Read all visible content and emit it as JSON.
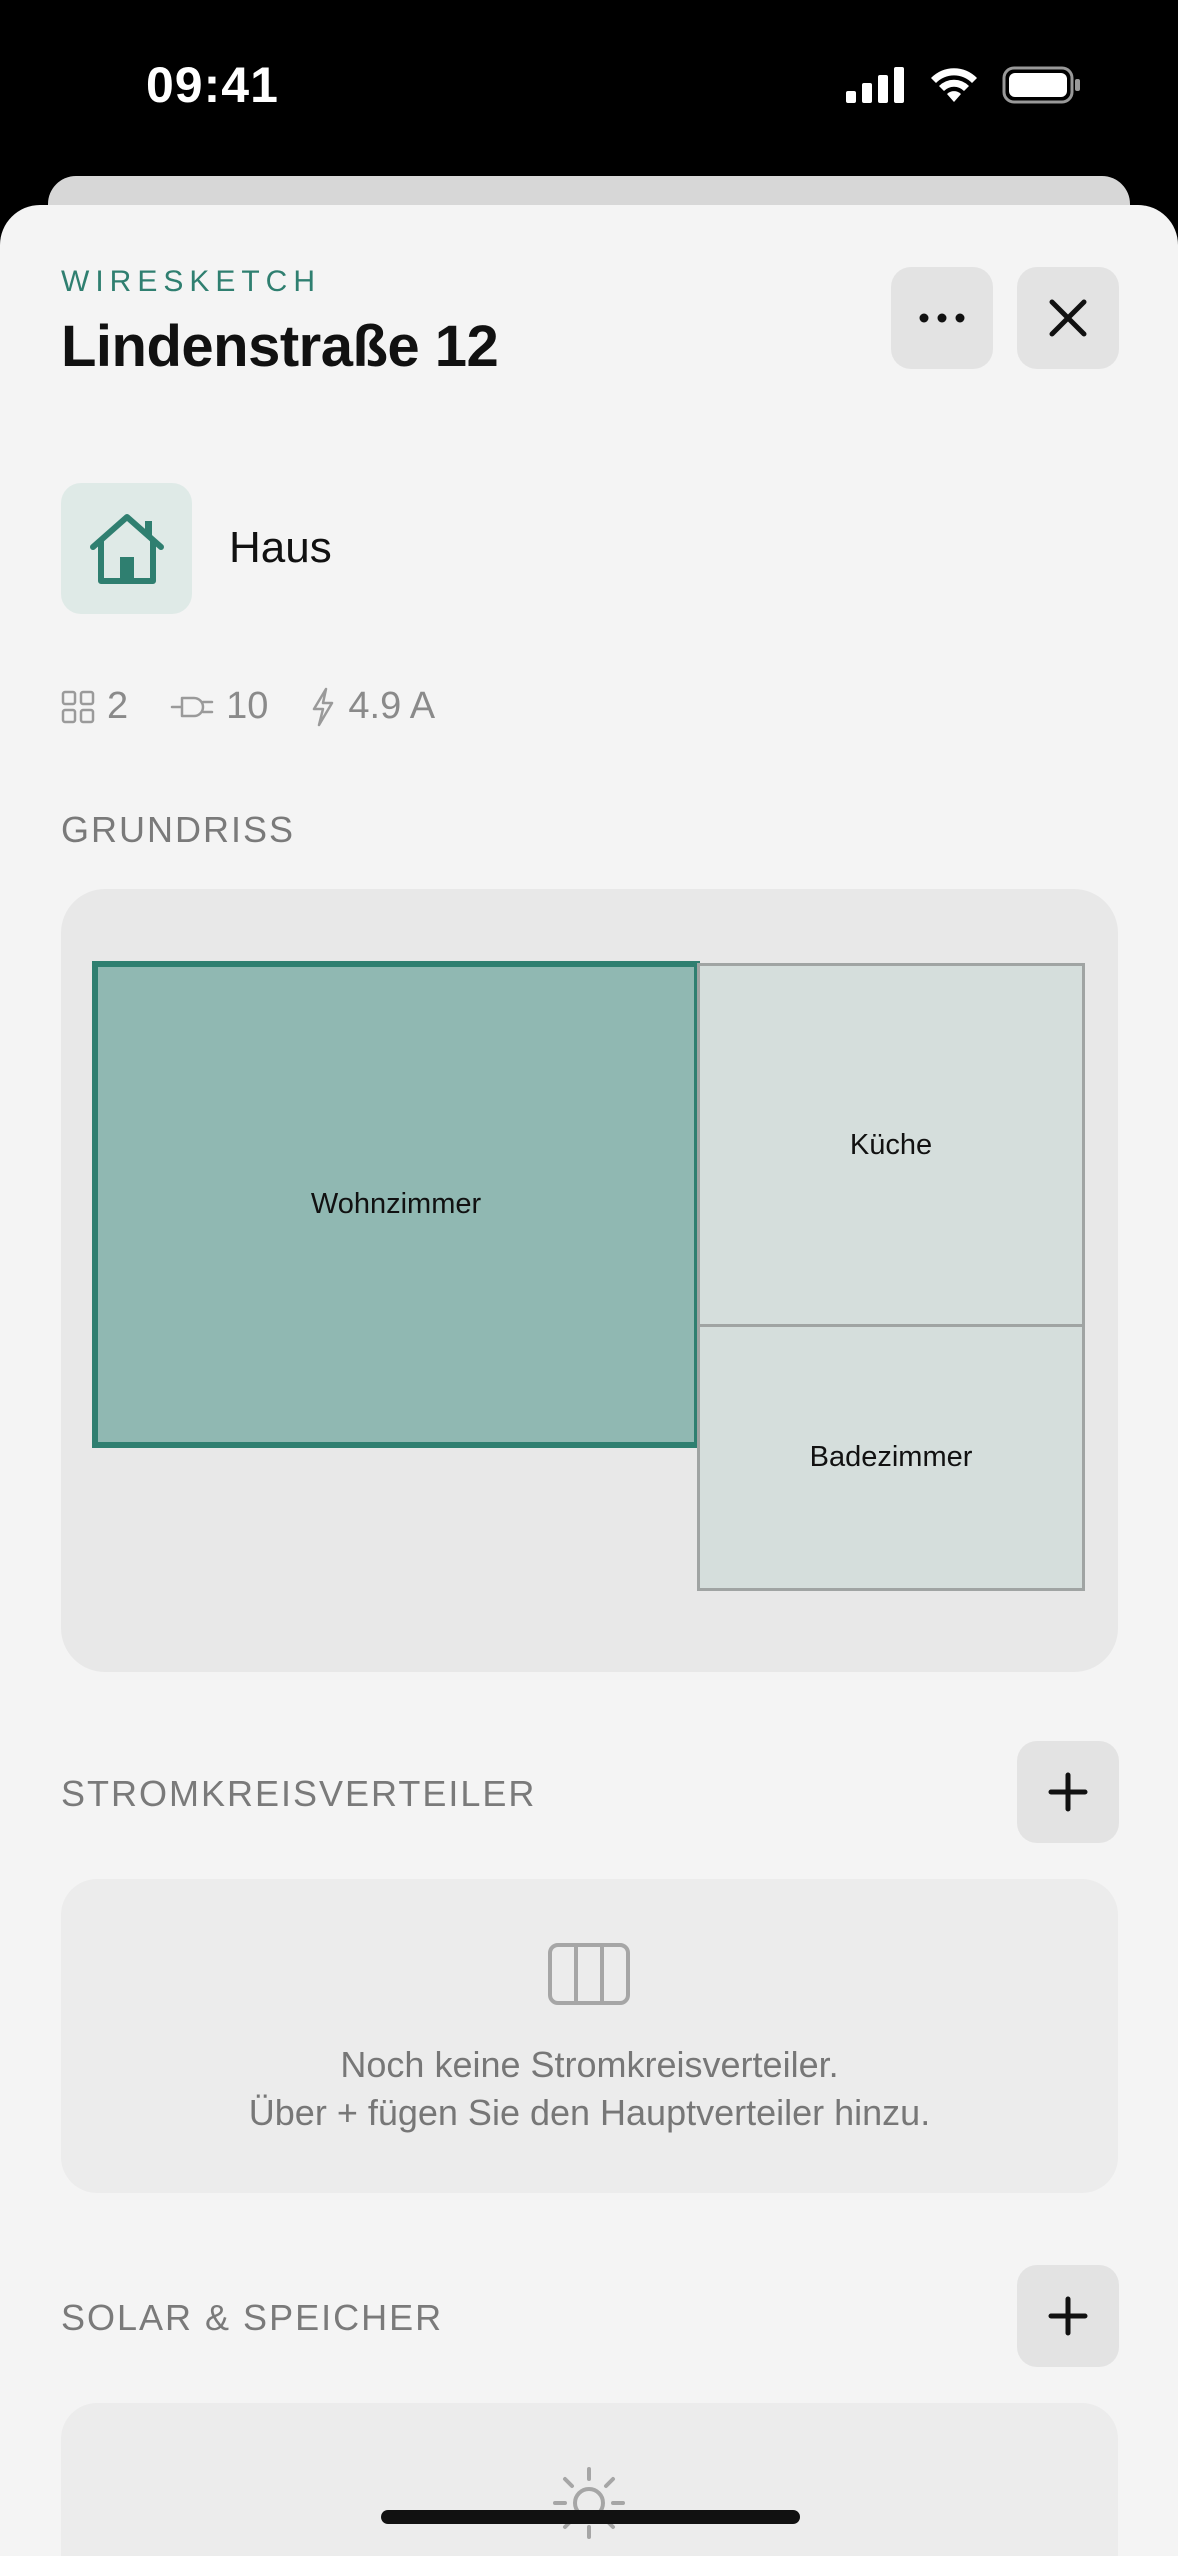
{
  "status": {
    "time": "09:41"
  },
  "header": {
    "brand": "WIRESKETCH",
    "title": "Lindenstraße 12"
  },
  "building": {
    "name": "Haus",
    "icon": "house-icon"
  },
  "stats": {
    "rooms": "2",
    "outlets": "10",
    "current": "4.9 A"
  },
  "floorplan": {
    "label": "GRUNDRISS",
    "rooms": [
      {
        "name": "Wohnzimmer",
        "selected": true
      },
      {
        "name": "Küche",
        "selected": false
      },
      {
        "name": "Badezimmer",
        "selected": false
      }
    ]
  },
  "distribution": {
    "label": "STROMKREISVERTEILER",
    "empty_line1": "Noch keine Stromkreisverteiler.",
    "empty_line2": "Über + fügen Sie den Hauptverteiler hinzu."
  },
  "solar": {
    "label": "SOLAR & SPEICHER"
  },
  "colors": {
    "accent": "#2f7f70",
    "selected_room": "#90b8b2",
    "room": "#d5dedc"
  }
}
